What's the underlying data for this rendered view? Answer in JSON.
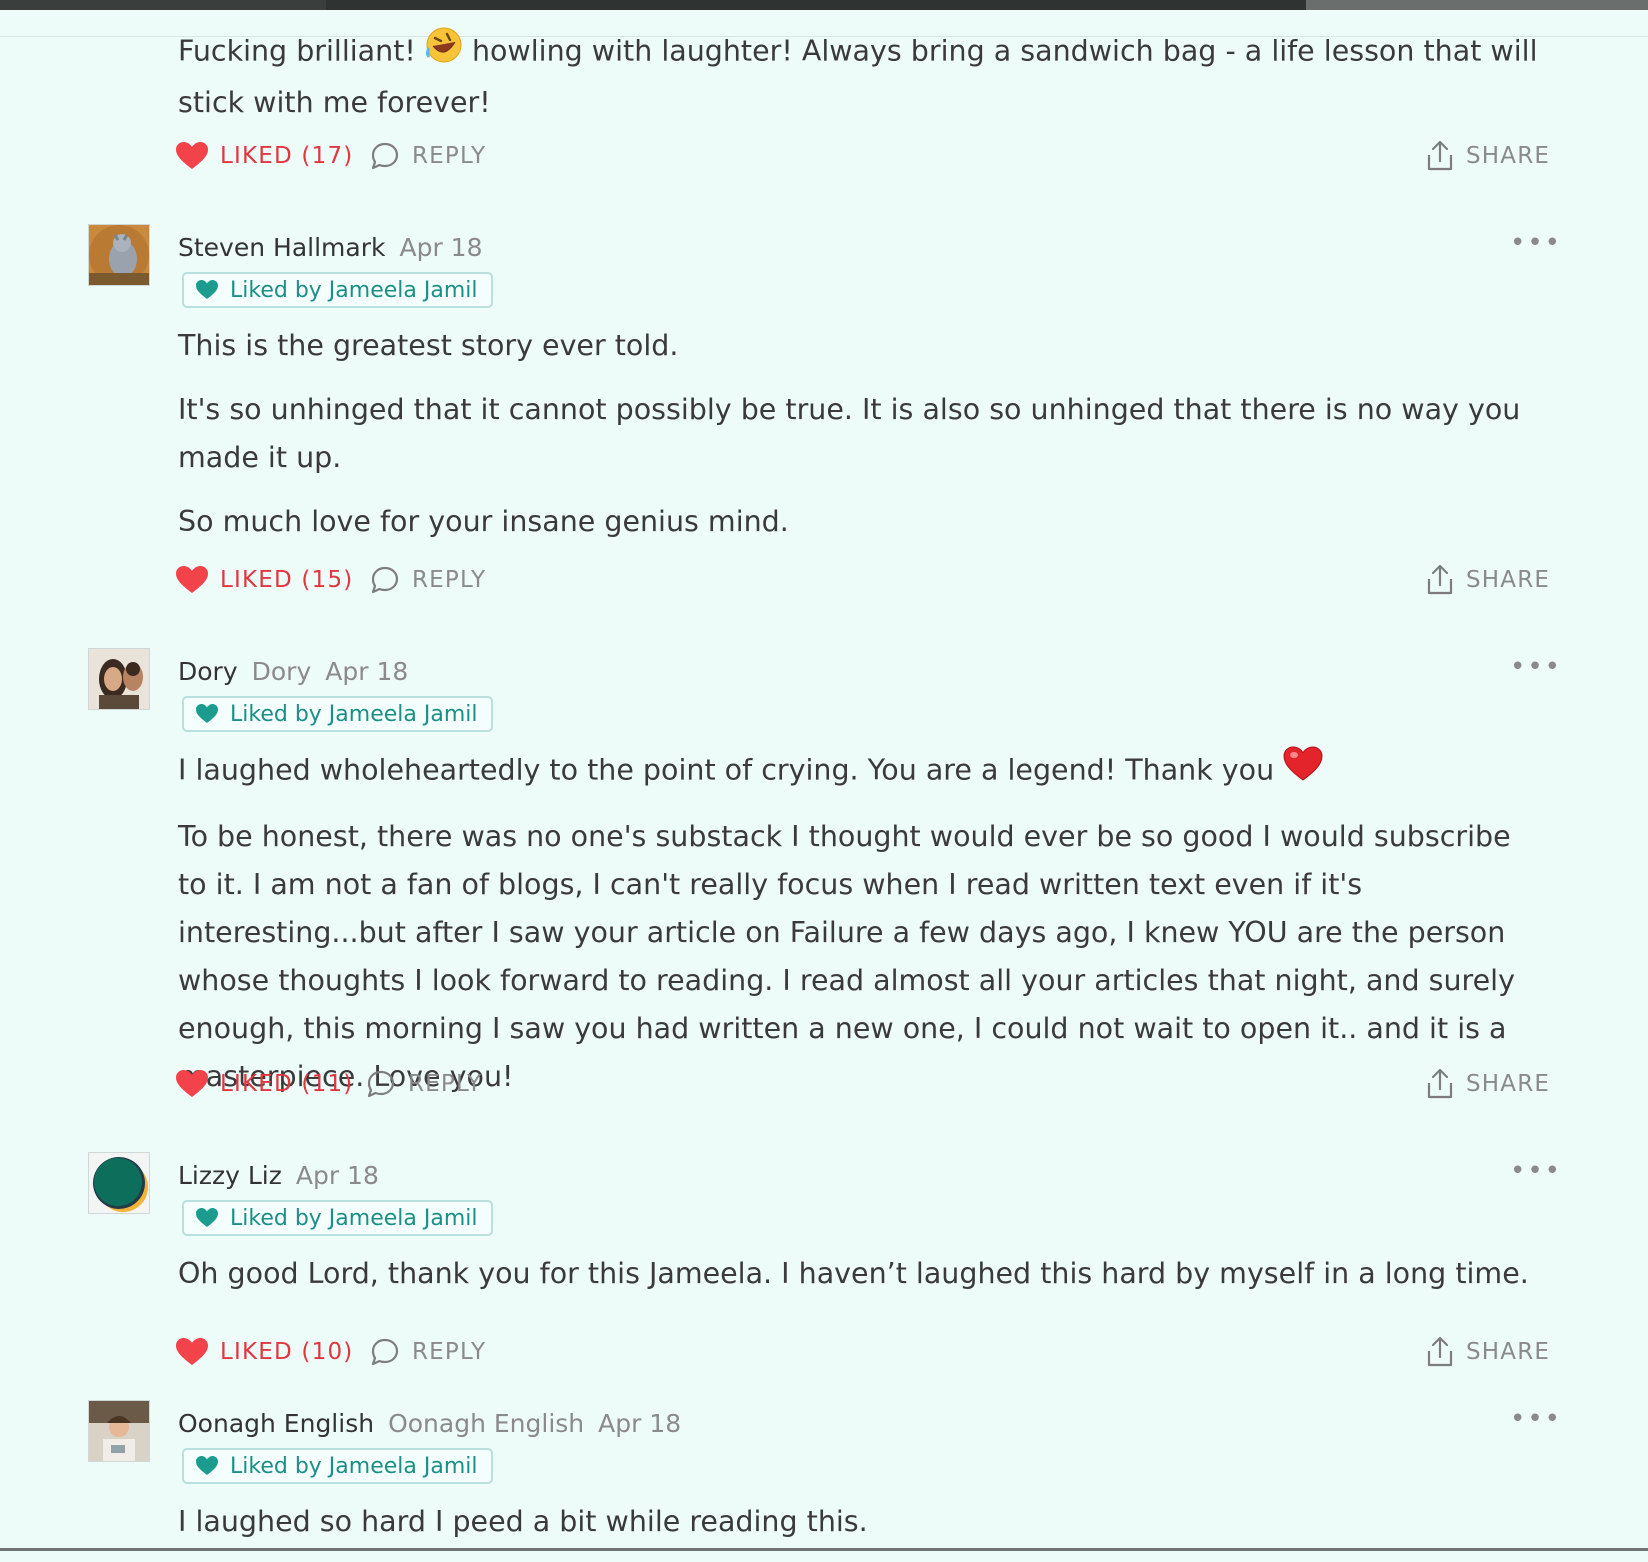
{
  "colors": {
    "background": "#edfcf9",
    "like": "#e0363e",
    "badge": "#1b8f86",
    "muted": "#8a8a8a"
  },
  "icons": {
    "like": "heart-icon",
    "reply": "speech-bubble-icon",
    "share": "share-icon",
    "more": "more-dots-icon",
    "badge": "teal-heart-icon"
  },
  "labels": {
    "more": "•••",
    "share": "SHARE"
  },
  "comments": [
    {
      "paragraphs": [
        "Fucking brilliant!",
        "howling with laughter! Always bring a sandwich bag - a life lesson that will stick with me forever!"
      ],
      "like_label": "LIKED (17)",
      "reply_label": "REPLY",
      "share_label": "SHARE"
    },
    {
      "author": "Steven Hallmark",
      "date": "Apr 18",
      "badge": "Liked by Jameela Jamil",
      "paragraphs": [
        "This is the greatest story ever told.",
        "It's so unhinged that it cannot possibly be true. It is also so unhinged that there is no way you made it up.",
        "So much love for your insane genius mind."
      ],
      "like_label": "LIKED (15)",
      "reply_label": "REPLY",
      "share_label": "SHARE"
    },
    {
      "author": "Dory",
      "subname": "Dory",
      "date": "Apr 18",
      "badge": "Liked by Jameela Jamil",
      "paragraphs": [
        "I laughed wholeheartedly to the point of crying. You are a legend! Thank you",
        "To be honest, there was no one's substack I thought would ever be so good I would subscribe to it. I am not a fan of blogs, I can't really focus when I read written text even if it's interesting...but after I saw your article on Failure a few days ago, I knew YOU are the person whose thoughts I look forward to reading. I read almost all your articles that night, and surely enough, this morning I saw you had written a new one, I could not wait to open it.. and it is a masterpiece. Love you!"
      ],
      "like_label": "LIKED (11)",
      "reply_label": "REPLY",
      "share_label": "SHARE"
    },
    {
      "author": "Lizzy Liz",
      "date": "Apr 18",
      "badge": "Liked by Jameela Jamil",
      "paragraphs": [
        "Oh good Lord, thank you for this Jameela. I haven’t laughed this hard by myself in a long time."
      ],
      "like_label": "LIKED (10)",
      "reply_label": "REPLY",
      "share_label": "SHARE"
    },
    {
      "author": "Oonagh English",
      "subname": "Oonagh English",
      "date": "Apr 18",
      "badge": "Liked by Jameela Jamil",
      "paragraphs": [
        "I laughed so hard I peed a bit while reading this."
      ]
    }
  ]
}
